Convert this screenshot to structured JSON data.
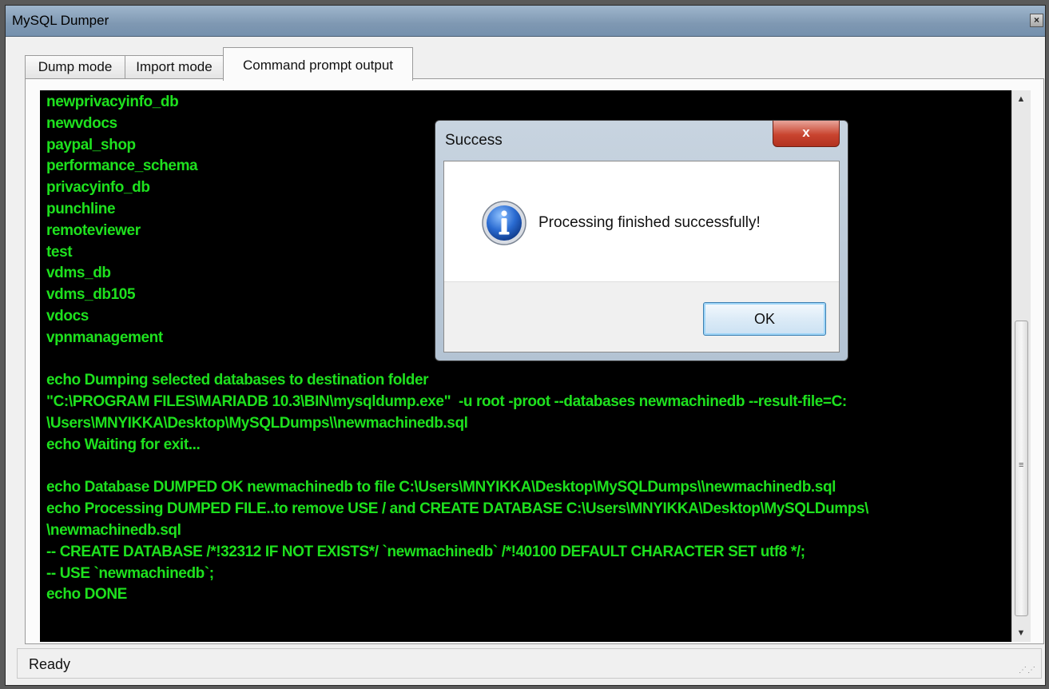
{
  "window": {
    "title": "MySQL Dumper",
    "close_glyph": "×"
  },
  "tabs": [
    {
      "label": "Dump mode"
    },
    {
      "label": "Import mode"
    },
    {
      "label": "Command prompt output"
    }
  ],
  "console": {
    "text_color": "#1ee11e",
    "lines": [
      "newprivacyinfo_db",
      "newvdocs",
      "paypal_shop",
      "performance_schema",
      "privacyinfo_db",
      "punchline",
      "remoteviewer",
      "test",
      "vdms_db",
      "vdms_db105",
      "vdocs",
      "vpnmanagement",
      "",
      "echo Dumping selected databases to destination folder",
      "\"C:\\PROGRAM FILES\\MARIADB 10.3\\BIN\\mysqldump.exe\"  -u root -proot --databases newmachinedb --result-file=C:",
      "\\Users\\MNYIKKA\\Desktop\\MySQLDumps\\\\newmachinedb.sql",
      "echo Waiting for exit...",
      "",
      "echo Database DUMPED OK newmachinedb to file C:\\Users\\MNYIKKA\\Desktop\\MySQLDumps\\\\newmachinedb.sql",
      "echo Processing DUMPED FILE..to remove USE / and CREATE DATABASE C:\\Users\\MNYIKKA\\Desktop\\MySQLDumps\\",
      "\\newmachinedb.sql",
      "-- CREATE DATABASE /*!32312 IF NOT EXISTS*/ `newmachinedb` /*!40100 DEFAULT CHARACTER SET utf8 */;",
      "-- USE `newmachinedb`;",
      "echo DONE"
    ]
  },
  "statusbar": {
    "status": "Ready"
  },
  "dialog": {
    "title": "Success",
    "close_glyph": "x",
    "message": "Processing finished successfully!",
    "ok_label": "OK",
    "icon": "info-icon"
  }
}
